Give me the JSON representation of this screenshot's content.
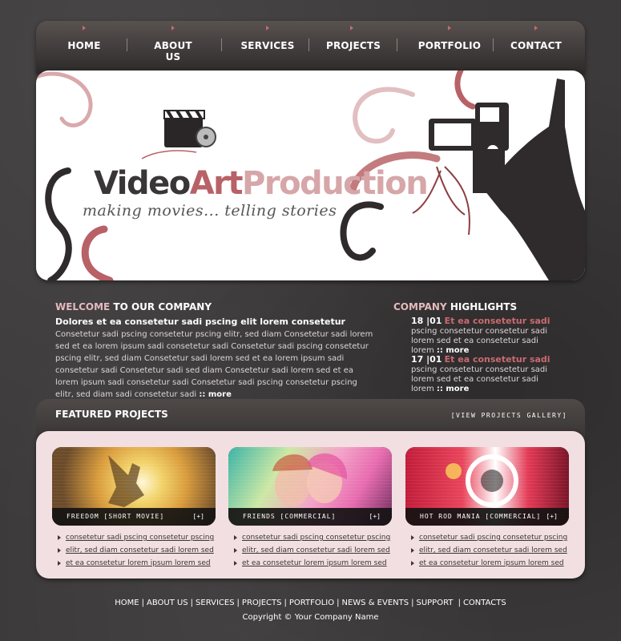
{
  "nav": {
    "items": [
      {
        "label": "HOME"
      },
      {
        "label": "ABOUT US"
      },
      {
        "label": "SERVICES"
      },
      {
        "label": "PROJECTS"
      },
      {
        "label": "PORTFOLIO"
      },
      {
        "label": "CONTACT"
      }
    ]
  },
  "banner": {
    "logo_video": "Video",
    "logo_art": "Art",
    "logo_production": "Production",
    "tagline": "making movies... telling stories"
  },
  "welcome": {
    "title_highlight": "WELCOME",
    "title_rest": " TO OUR COMPANY",
    "subtitle": "Dolores et ea consetetur sadi pscing elit lorem consetetur",
    "body": "Consetetur sadi pscing consetetur pscing elitr, sed diam Consetetur sadi lorem sed  et ea lorem ipsum sadi consetetur sadi Consetetur sadi pscing consetetur pscing elitr, sed diam Consetetur sadi lorem sed  et ea lorem ipsum sadi consetetur sadi  Consetetur sadi sed diam Consetetur sadi lorem sed  et ea lorem ipsum sadi consetetur sadi  Consetetur sadi pscing consetetur pscing elitr, sed diam sadi consetetur sadi ",
    "more": ":: more"
  },
  "highlights": {
    "title_highlight": "COMPANY",
    "title_rest": " HIGHLIGHTS",
    "items": [
      {
        "date": "18 |01",
        "headline": "Et ea consetetur sadi",
        "text": "pscing consetetur consetetur sadi lorem sed  et ea consetetur sadi lorem ",
        "more": ":: more"
      },
      {
        "date": "17 |01",
        "headline": "Et ea consetetur sadi",
        "text": "pscing consetetur consetetur sadi lorem sed  et ea consetetur sadi lorem ",
        "more": ":: more"
      }
    ]
  },
  "featured": {
    "title": "FEATURED PROJECTS",
    "gallery_link": "[VIEW PROJECTS GALLERY]",
    "plus": "[+]",
    "cards": [
      {
        "caption": "FREEDOM [SHORT MOVIE]",
        "links": [
          "consetetur sadi pscing consetetur pscing",
          "elitr, sed diam consetetur sadi lorem sed ",
          "et ea consetetur lorem ipsum lorem sed "
        ]
      },
      {
        "caption": "FRIENDS [COMMERCIAL]",
        "links": [
          "consetetur sadi pscing consetetur pscing",
          "elitr, sed diam consetetur sadi lorem sed ",
          "et ea consetetur lorem ipsum lorem sed "
        ]
      },
      {
        "caption": "HOT ROD MANIA [COMMERCIAL]",
        "links": [
          "consetetur sadi pscing consetetur pscing",
          "elitr, sed diam consetetur sadi lorem sed ",
          "et ea consetetur lorem ipsum lorem sed "
        ]
      }
    ]
  },
  "footer": {
    "links": [
      "HOME",
      "ABOUT US",
      "SERVICES",
      "PROJECTS",
      "PORTFOLIO",
      "NEWS & EVENTS",
      "SUPPORT ",
      "CONTACTS"
    ],
    "copyright": "Copyright © Your Company Name"
  },
  "colors": {
    "accent": "#c96b70",
    "background": "#3d3a3b",
    "panel": "#f1dfe1"
  }
}
